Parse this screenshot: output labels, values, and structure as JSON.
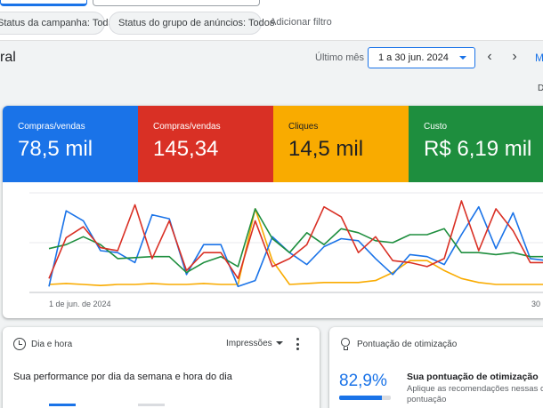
{
  "filters": {
    "campaign_status": "Status da campanha: Todas",
    "adgroup_status": "Status do grupo de anúncios: Todos",
    "add_filter": "Adicionar filtro"
  },
  "header": {
    "title": "ral",
    "range_label": "Último mês",
    "date_range": "1 a 30 jun. 2024",
    "more": "M",
    "edge_letter": "D"
  },
  "metrics": [
    {
      "label": "Compras/vendas",
      "value": "78,5 mil",
      "color": "#1a73e8"
    },
    {
      "label": "Compras/vendas",
      "value": "145,34",
      "color": "#d93025"
    },
    {
      "label": "Cliques",
      "value": "14,5 mil",
      "color": "#f9ab00"
    },
    {
      "label": "Custo",
      "value": "R$ 6,19 mil",
      "color": "#1e8e3e"
    }
  ],
  "chart_data": {
    "type": "line",
    "x": [
      1,
      2,
      3,
      4,
      5,
      6,
      7,
      8,
      9,
      10,
      11,
      12,
      13,
      14,
      15,
      16,
      17,
      18,
      19,
      20,
      21,
      22,
      23,
      24,
      25,
      26,
      27,
      28,
      29,
      30
    ],
    "x_tick_labels": [
      "1 de jun. de 2024",
      "30"
    ],
    "ylim": [
      0,
      1
    ],
    "grid": true,
    "series": [
      {
        "color": "#1a73e8",
        "values": [
          0.06,
          0.82,
          0.72,
          0.42,
          0.4,
          0.3,
          0.78,
          0.74,
          0.18,
          0.48,
          0.48,
          0.06,
          0.12,
          0.56,
          0.4,
          0.28,
          0.46,
          0.54,
          0.52,
          0.34,
          0.18,
          0.38,
          0.36,
          0.28,
          0.58,
          0.86,
          0.44,
          0.8,
          0.34,
          0.32
        ]
      },
      {
        "color": "#d93025",
        "values": [
          0.14,
          0.55,
          0.66,
          0.45,
          0.42,
          0.88,
          0.34,
          0.72,
          0.22,
          0.4,
          0.4,
          0.14,
          0.72,
          0.26,
          0.34,
          0.48,
          0.86,
          0.76,
          0.4,
          0.56,
          0.32,
          0.3,
          0.26,
          0.34,
          0.92,
          0.42,
          0.84,
          0.62,
          0.3,
          0.3
        ]
      },
      {
        "color": "#1e8e3e",
        "values": [
          0.44,
          0.48,
          0.56,
          0.48,
          0.34,
          0.35,
          0.36,
          0.36,
          0.2,
          0.3,
          0.36,
          0.26,
          0.84,
          0.54,
          0.4,
          0.6,
          0.48,
          0.64,
          0.6,
          0.52,
          0.5,
          0.58,
          0.58,
          0.64,
          0.4,
          0.4,
          0.38,
          0.4,
          0.36,
          0.36
        ]
      },
      {
        "color": "#f9ab00",
        "values": [
          0.08,
          0.09,
          0.08,
          0.07,
          0.08,
          0.08,
          0.09,
          0.08,
          0.08,
          0.09,
          0.08,
          0.08,
          0.84,
          0.32,
          0.08,
          0.09,
          0.1,
          0.1,
          0.1,
          0.12,
          0.2,
          0.32,
          0.32,
          0.22,
          0.14,
          0.1,
          0.08,
          0.08,
          0.08,
          0.08
        ]
      }
    ]
  },
  "daytime_card": {
    "title": "Dia e hora",
    "metric_select": "Impressões",
    "subtitle": "Sua performance por dia da semana e hora do dia"
  },
  "optim_card": {
    "title": "Pontuação de otimização",
    "score": "82,9%",
    "score_fraction": 0.829,
    "headline": "Sua pontuação de otimização",
    "description": "Aplique as recomendações nessas co pontuação"
  }
}
